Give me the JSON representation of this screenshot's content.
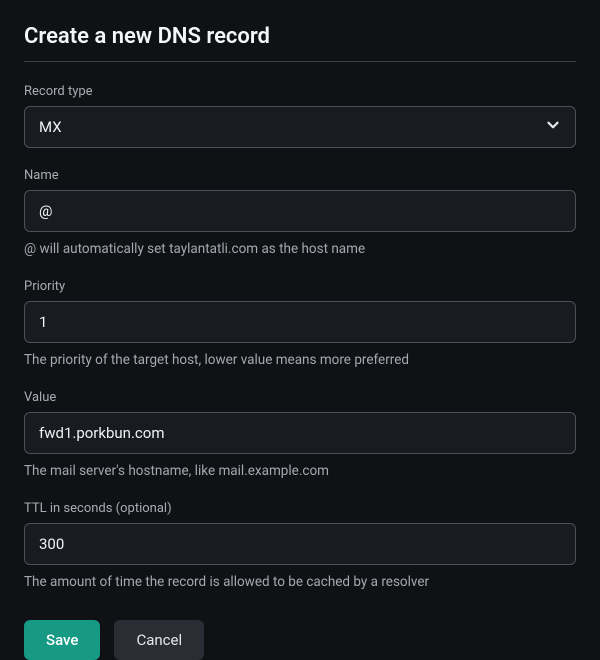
{
  "title": "Create a new DNS record",
  "fields": {
    "record_type": {
      "label": "Record type",
      "value": "MX"
    },
    "name": {
      "label": "Name",
      "value": "@",
      "help": "@ will automatically set taylantatli.com as the host name"
    },
    "priority": {
      "label": "Priority",
      "value": "1",
      "help": "The priority of the target host, lower value means more preferred"
    },
    "value": {
      "label": "Value",
      "value": "fwd1.porkbun.com",
      "help": "The mail server's hostname, like mail.example.com"
    },
    "ttl": {
      "label": "TTL in seconds (optional)",
      "value": "300",
      "help": "The amount of time the record is allowed to be cached by a resolver"
    }
  },
  "actions": {
    "save": "Save",
    "cancel": "Cancel"
  }
}
